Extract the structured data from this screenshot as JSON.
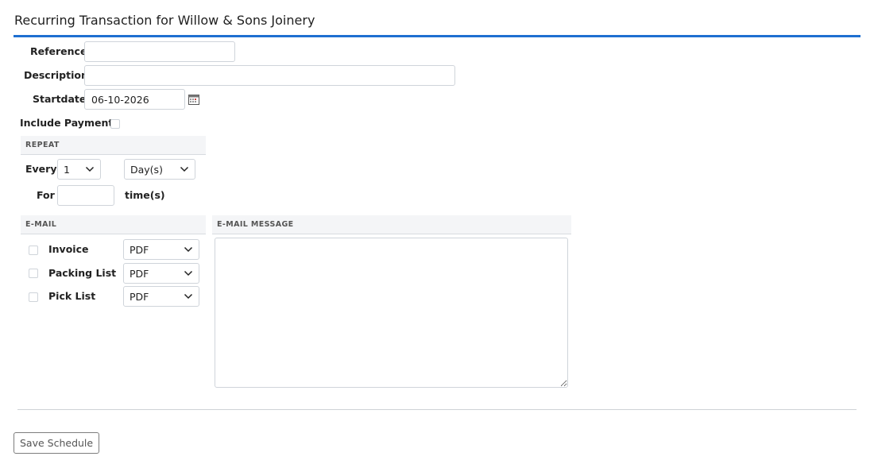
{
  "header": {
    "title": "Recurring Transaction for Willow & Sons Joinery"
  },
  "form": {
    "reference": {
      "label": "Reference",
      "value": ""
    },
    "description": {
      "label": "Description",
      "value": ""
    },
    "startdate": {
      "label": "Startdate",
      "value": "06-10-2026"
    },
    "include_payment": {
      "label": "Include Payment",
      "checked": false
    }
  },
  "repeat": {
    "heading": "REPEAT",
    "every_label": "Every",
    "every_value": "1",
    "unit_value": "Day(s)",
    "for_label": "For",
    "for_value": "",
    "times_label": "time(s)"
  },
  "email": {
    "heading": "E-MAIL",
    "rows": [
      {
        "label": "Invoice",
        "format": "PDF",
        "checked": false
      },
      {
        "label": "Packing List",
        "format": "PDF",
        "checked": false
      },
      {
        "label": "Pick List",
        "format": "PDF",
        "checked": false
      }
    ]
  },
  "email_message": {
    "heading": "E-MAIL MESSAGE",
    "value": ""
  },
  "actions": {
    "save_label": "Save Schedule"
  },
  "colors": {
    "accent": "#1f6fd1",
    "border": "#cfd4da",
    "section_bg": "#f4f5f7"
  }
}
